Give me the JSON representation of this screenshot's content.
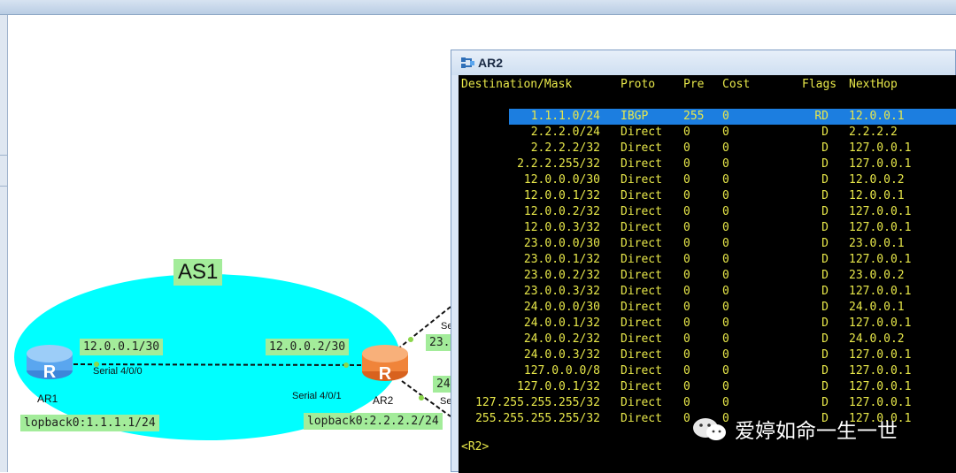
{
  "terminal": {
    "title": "AR2",
    "headers": {
      "dest": "Destination/Mask",
      "proto": "Proto",
      "pre": "Pre",
      "cost": "Cost",
      "flags": "Flags",
      "nexthop": "NextHop"
    },
    "routes": [
      {
        "dest": "1.1.1.0/24",
        "proto": "IBGP",
        "pre": "255",
        "cost": "0",
        "flags": "RD",
        "nexthop": "12.0.0.1"
      },
      {
        "dest": "2.2.2.0/24",
        "proto": "Direct",
        "pre": "0",
        "cost": "0",
        "flags": "D",
        "nexthop": "2.2.2.2"
      },
      {
        "dest": "2.2.2.2/32",
        "proto": "Direct",
        "pre": "0",
        "cost": "0",
        "flags": "D",
        "nexthop": "127.0.0.1"
      },
      {
        "dest": "2.2.2.255/32",
        "proto": "Direct",
        "pre": "0",
        "cost": "0",
        "flags": "D",
        "nexthop": "127.0.0.1"
      },
      {
        "dest": "12.0.0.0/30",
        "proto": "Direct",
        "pre": "0",
        "cost": "0",
        "flags": "D",
        "nexthop": "12.0.0.2"
      },
      {
        "dest": "12.0.0.1/32",
        "proto": "Direct",
        "pre": "0",
        "cost": "0",
        "flags": "D",
        "nexthop": "12.0.0.1"
      },
      {
        "dest": "12.0.0.2/32",
        "proto": "Direct",
        "pre": "0",
        "cost": "0",
        "flags": "D",
        "nexthop": "127.0.0.1"
      },
      {
        "dest": "12.0.0.3/32",
        "proto": "Direct",
        "pre": "0",
        "cost": "0",
        "flags": "D",
        "nexthop": "127.0.0.1"
      },
      {
        "dest": "23.0.0.0/30",
        "proto": "Direct",
        "pre": "0",
        "cost": "0",
        "flags": "D",
        "nexthop": "23.0.0.1"
      },
      {
        "dest": "23.0.0.1/32",
        "proto": "Direct",
        "pre": "0",
        "cost": "0",
        "flags": "D",
        "nexthop": "127.0.0.1"
      },
      {
        "dest": "23.0.0.2/32",
        "proto": "Direct",
        "pre": "0",
        "cost": "0",
        "flags": "D",
        "nexthop": "23.0.0.2"
      },
      {
        "dest": "23.0.0.3/32",
        "proto": "Direct",
        "pre": "0",
        "cost": "0",
        "flags": "D",
        "nexthop": "127.0.0.1"
      },
      {
        "dest": "24.0.0.0/30",
        "proto": "Direct",
        "pre": "0",
        "cost": "0",
        "flags": "D",
        "nexthop": "24.0.0.1"
      },
      {
        "dest": "24.0.0.1/32",
        "proto": "Direct",
        "pre": "0",
        "cost": "0",
        "flags": "D",
        "nexthop": "127.0.0.1"
      },
      {
        "dest": "24.0.0.2/32",
        "proto": "Direct",
        "pre": "0",
        "cost": "0",
        "flags": "D",
        "nexthop": "24.0.0.2"
      },
      {
        "dest": "24.0.0.3/32",
        "proto": "Direct",
        "pre": "0",
        "cost": "0",
        "flags": "D",
        "nexthop": "127.0.0.1"
      },
      {
        "dest": "127.0.0.0/8",
        "proto": "Direct",
        "pre": "0",
        "cost": "0",
        "flags": "D",
        "nexthop": "127.0.0.1"
      },
      {
        "dest": "127.0.0.1/32",
        "proto": "Direct",
        "pre": "0",
        "cost": "0",
        "flags": "D",
        "nexthop": "127.0.0.1"
      },
      {
        "dest": "127.255.255.255/32",
        "proto": "Direct",
        "pre": "0",
        "cost": "0",
        "flags": "D",
        "nexthop": "127.0.0.1"
      },
      {
        "dest": "255.255.255.255/32",
        "proto": "Direct",
        "pre": "0",
        "cost": "0",
        "flags": "D",
        "nexthop": "127.0.0.1"
      }
    ],
    "prompt": "<R2>",
    "icon": "router-console-icon"
  },
  "topology": {
    "as_label": "AS1",
    "ar1": {
      "name": "AR1",
      "ip": "12.0.0.1/30",
      "iface": "Serial 4/0/0",
      "loopback": "lopback0:1.1.1.1/24"
    },
    "ar2": {
      "name": "AR2",
      "ip": "12.0.0.2/30",
      "iface": "Serial 4/0/1",
      "loopback": "lopback0:2.2.2.2/24"
    },
    "partial_labels": {
      "label_23": "23.",
      "label_24": "24",
      "serial_top": "Se",
      "serial_bottom": "Se"
    },
    "colors": {
      "as_cloud": "#00ffff",
      "label_bg": "#a3ec9a",
      "highlight": "#1c7ee0",
      "term_text": "#e8e84a"
    }
  },
  "watermark": {
    "text": "爱婷如命一生一世",
    "icon": "wechat-icon"
  }
}
